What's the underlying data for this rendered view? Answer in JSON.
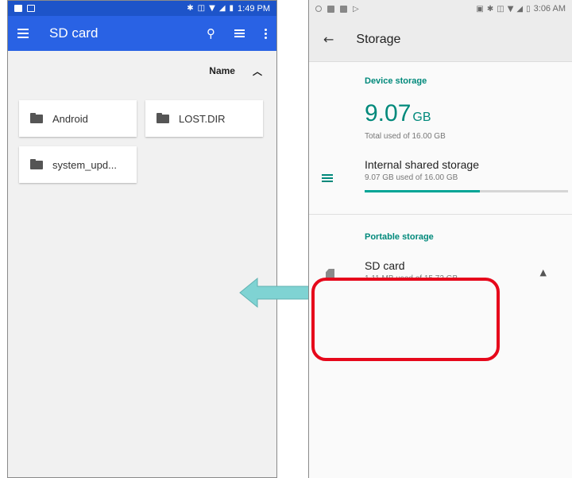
{
  "left_phone": {
    "status_time": "1:49 PM",
    "app_title": "SD card",
    "sort_label": "Name",
    "folders": [
      {
        "name": "Android"
      },
      {
        "name": "LOST.DIR"
      },
      {
        "name": "system_upd..."
      }
    ]
  },
  "right_phone": {
    "status_time": "3:06 AM",
    "app_title": "Storage",
    "device_storage": {
      "header": "Device storage",
      "used_value": "9.07",
      "used_unit": "GB",
      "total_text": "Total used of 16.00 GB"
    },
    "internal": {
      "title": "Internal shared storage",
      "subtitle": "9.07 GB used of 16.00 GB",
      "fraction_used": 0.567
    },
    "portable": {
      "header": "Portable storage",
      "sd_title": "SD card",
      "sd_subtitle": "1.11 MB used of 15.72 GB"
    }
  },
  "colors": {
    "left_status": "#1d54c9",
    "left_appbar": "#2962e4",
    "teal_accent": "#00897b",
    "highlight_red": "#e6081b",
    "arrow_fill": "#7fd3d3"
  },
  "icons": [
    "menu-icon",
    "search-icon",
    "list-view-icon",
    "more-vert-icon",
    "sort-ascending-icon",
    "folder-icon",
    "back-arrow-icon",
    "storage-list-icon",
    "sd-card-icon",
    "eject-icon",
    "left-arrow-annotation"
  ]
}
